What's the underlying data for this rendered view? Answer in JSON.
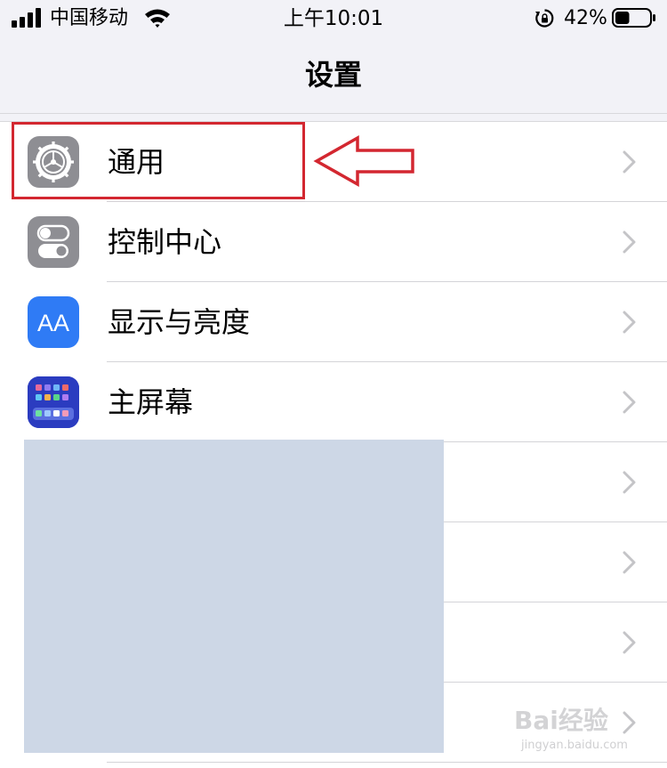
{
  "status_bar": {
    "carrier": "中国移动",
    "time": "上午10:01",
    "battery_percent": "42%",
    "battery_level": 0.42,
    "icons": [
      "signal-icon",
      "wifi-icon",
      "rotation-lock-icon",
      "battery-icon"
    ]
  },
  "nav": {
    "title": "设置"
  },
  "settings": {
    "items": [
      {
        "label": "通用",
        "icon": "gear-icon",
        "icon_color": "#8e8e93"
      },
      {
        "label": "控制中心",
        "icon": "toggle-switches-icon",
        "icon_color": "#8e8e93"
      },
      {
        "label": "显示与亮度",
        "icon": "text-size-icon",
        "icon_text": "AA",
        "icon_color": "#2f7bf5"
      },
      {
        "label": "主屏幕",
        "icon": "app-grid-icon",
        "icon_color": "#2f3fc7"
      }
    ],
    "hidden_rows_count": 4
  },
  "annotation": {
    "color": "#d32730"
  },
  "watermark": {
    "brand": "Bai经验",
    "url": "jingyan.baidu.com"
  }
}
